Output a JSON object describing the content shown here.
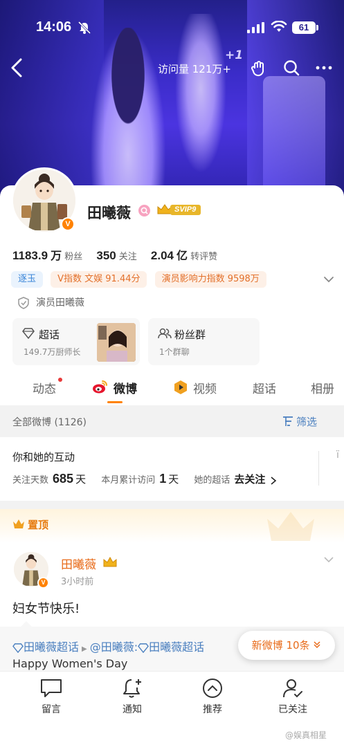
{
  "status_bar": {
    "time": "14:06",
    "battery": "61"
  },
  "top_nav": {
    "visits": "访问量 121万+",
    "plus_one": "+1"
  },
  "profile": {
    "name": "田曦薇",
    "svip": "SVIP9",
    "stats": [
      {
        "num": "1183.9",
        "unit": "万",
        "label": "粉丝"
      },
      {
        "num": "350",
        "unit": "",
        "label": "关注"
      },
      {
        "num": "2.04",
        "unit": "亿",
        "label": "转评赞"
      }
    ],
    "tags": [
      {
        "text": "逐玉",
        "style": "blue"
      },
      {
        "text": "V指数 文娱 91.44分",
        "style": "orange"
      },
      {
        "text": "演员影响力指数 9598万",
        "style": "orange"
      }
    ],
    "verification": "演员田曦薇",
    "tiles": {
      "super_topic": {
        "title": "超话",
        "sub": "149.7万厨师长"
      },
      "fan_group": {
        "title": "粉丝群",
        "sub": "1个群聊"
      }
    }
  },
  "tabs": [
    "动态",
    "微博",
    "视频",
    "超话",
    "相册"
  ],
  "feed": {
    "all_label": "全部微博 (1126)",
    "filter_label": "筛选",
    "interaction": {
      "title": "你和她的互动",
      "follow_days_label": "关注天数",
      "follow_days_value": "685",
      "follow_days_unit": "天",
      "month_visits_label": "本月累计访问",
      "month_visits_value": "1",
      "month_visits_unit": "天",
      "super_topic_label": "她的超话",
      "super_topic_action": "去关注"
    },
    "pinned_label": "置顶",
    "post": {
      "author": "田曦薇",
      "time": "3小时前",
      "text": "妇女节快乐!",
      "repost_topic": "田曦薇超话",
      "repost_user": "@田曦薇:",
      "repost_topic2": "田曦薇超话",
      "repost_line2": "Happy Women's Day"
    },
    "new_posts": "新微博 10条"
  },
  "bottom_bar": [
    "留言",
    "通知",
    "推荐",
    "已关注"
  ],
  "watermark": "@娱真相星"
}
